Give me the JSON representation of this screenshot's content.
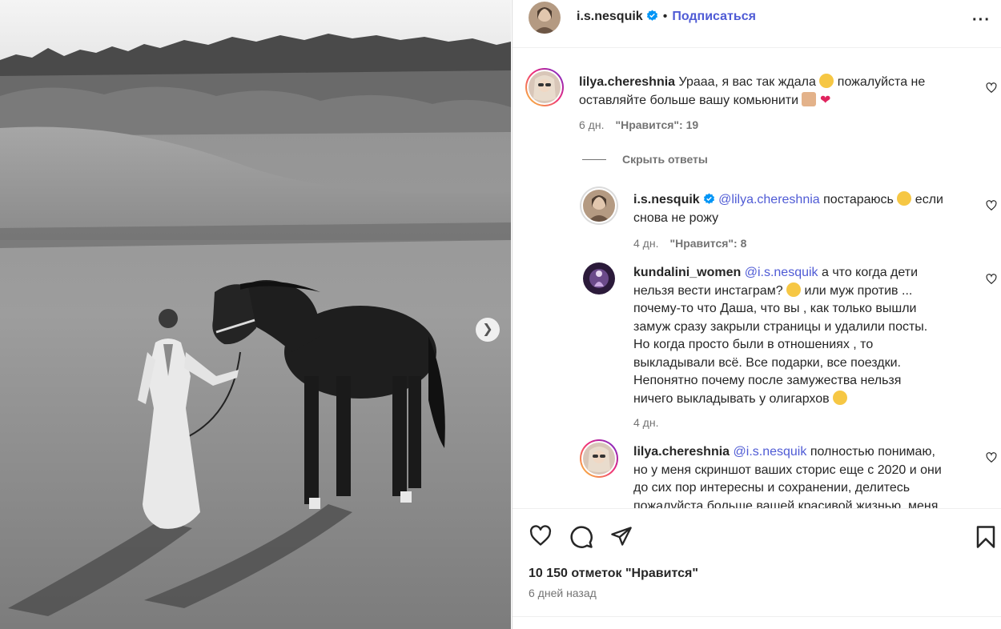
{
  "post": {
    "author": "i.s.nesquik",
    "follow_label": "Подписаться",
    "likes": "10 150 отметок \"Нравится\"",
    "posted_ago": "6 дней назад"
  },
  "hide_replies_label": "Скрыть ответы",
  "comments": [
    {
      "user": "lilya.chereshnia",
      "line1a": "Урааа, я вас так ждала",
      "line1b": "пожалуйста не",
      "line2": "оставляйте больше вашу комьюнити",
      "time": "6 дн.",
      "likes": "\"Нравится\": 19"
    },
    {
      "user": "i.s.nesquik",
      "mention": "@lilya.chereshnia",
      "line1a": "постараюсь",
      "line1b": "если",
      "line2": "снова не рожу",
      "time": "4 дн.",
      "likes": "\"Нравится\": 8"
    },
    {
      "user": "kundalini_women",
      "mention": "@i.s.nesquik",
      "line1": "а что когда дети",
      "line2a": "нельзя вести инстаграм?",
      "line2b": "или муж против ...",
      "line3": "почему-то что Даша, что вы , как только вышли",
      "line4": "замуж сразу закрыли страницы и удалили посты.",
      "line5": "Но когда просто были в отношениях , то",
      "line6": "выкладывали всё. Все подарки, все поездки.",
      "line7": "Непонятно почему после замужества нельзя",
      "line8": "ничего выкладывать у олигархов",
      "time": "4 дн."
    },
    {
      "user": "lilya.chereshnia",
      "mention": "@i.s.nesquik",
      "line1": "полностью понимаю,",
      "line2": "но у меня скриншот ваших сторис еще с 2020 и они",
      "line3": "до сих пор интересны и сохранении, делитесь",
      "line4": "пожалуйста больше вашей красивой жизнью, меня"
    }
  ],
  "icons": {
    "like": "heart-icon",
    "comment": "comment-bubble-icon",
    "share": "paper-plane-icon",
    "save": "bookmark-icon",
    "more": "more-horizontal-icon",
    "next": "chevron-right-icon",
    "verified": "verified-badge-icon"
  },
  "colors": {
    "accent": "#4f5bd5",
    "verified": "#0095f6",
    "muted": "#737373",
    "text": "#262626"
  }
}
